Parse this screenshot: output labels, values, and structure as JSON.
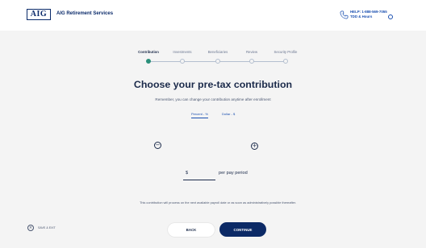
{
  "header": {
    "logo_text": "AIG",
    "brand": "AIG Retirement Services",
    "help_line1": "HELP: 1-888-569-7055",
    "help_line2": "TDD & Hours"
  },
  "steps": [
    {
      "label": "Contribution",
      "active": true
    },
    {
      "label": "Investments",
      "active": false
    },
    {
      "label": "Beneficiaries",
      "active": false
    },
    {
      "label": "Review",
      "active": false
    },
    {
      "label": "Security Profile",
      "active": false
    }
  ],
  "main": {
    "title": "Choose your pre-tax contribution",
    "subtitle": "Remember, you can change your contribution anytime after enrollment",
    "tabs": [
      {
        "label": "Percent - %",
        "active": true
      },
      {
        "label": "Dollar - $",
        "active": false
      }
    ],
    "decrement_symbol": "−",
    "increment_symbol": "+",
    "currency_symbol": "$",
    "amount_value": "",
    "per_period_label": "per pay period",
    "note": "This contribution will process on the next available payroll date or as soon as administratively possible thereafter."
  },
  "footer": {
    "save_exit_icon": "×",
    "save_exit_label": "SAVE & EXIT",
    "back_label": "BACK",
    "continue_label": "CONTINUE"
  },
  "colors": {
    "primary_navy": "#0c2a66",
    "link_blue": "#1a4fb0",
    "step_active_green": "#2a8f7a",
    "page_background": "#f4f4f4"
  },
  "icons": {
    "phone": "phone-icon",
    "info": "info-icon",
    "decrement": "minus-circle-icon",
    "increment": "plus-circle-icon",
    "close": "close-circle-icon"
  }
}
